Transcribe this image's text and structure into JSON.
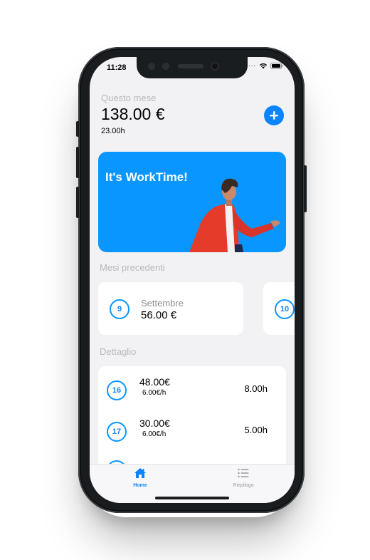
{
  "status_bar": {
    "time": "11:28"
  },
  "summary": {
    "label": "Questo mese",
    "amount": "138.00 €",
    "hours": "23.00h"
  },
  "banner": {
    "title": "It's WorkTime!"
  },
  "previous_months": {
    "title": "Mesi precedenti",
    "items": [
      {
        "number": "9",
        "name": "Settembre",
        "amount": "56.00 €"
      },
      {
        "number": "10"
      }
    ]
  },
  "detail": {
    "title": "Dettaglio",
    "rows": [
      {
        "day": "16",
        "amount": "48.00€",
        "rate": "6.00€/h",
        "hours": "8.00h"
      },
      {
        "day": "17",
        "amount": "30.00€",
        "rate": "6.00€/h",
        "hours": "5.00h"
      }
    ]
  },
  "tabbar": {
    "items": [
      {
        "label": "Home",
        "icon": "house-icon",
        "active": true
      },
      {
        "label": "Riepilogo",
        "icon": "list-icon",
        "active": false
      }
    ]
  },
  "colors": {
    "accent": "#0a84ff",
    "banner": "#0a96ff",
    "background": "#f2f2f4"
  }
}
